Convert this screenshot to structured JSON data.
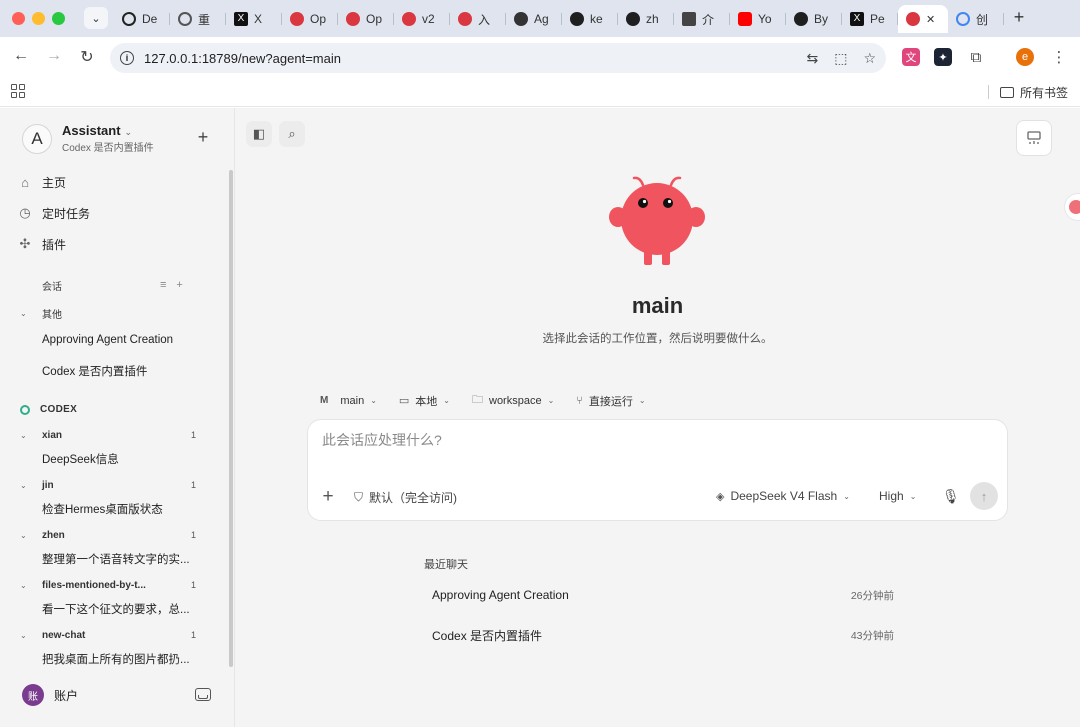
{
  "browser": {
    "tabs": [
      {
        "label": "De",
        "favicon": "ai-icon",
        "color": "#222222"
      },
      {
        "label": "重",
        "favicon": "openai-icon",
        "color": "#333333"
      },
      {
        "label": "X",
        "favicon": "x-icon",
        "color": "#111111"
      },
      {
        "label": "Op",
        "favicon": "crab-icon",
        "color": "#d93840"
      },
      {
        "label": "Op",
        "favicon": "crab-icon",
        "color": "#d93840"
      },
      {
        "label": "v2",
        "favicon": "crab-icon",
        "color": "#d93840"
      },
      {
        "label": "入",
        "favicon": "crab-icon",
        "color": "#d93840"
      },
      {
        "label": "Ag",
        "favicon": "agent-icon",
        "color": "#333333"
      },
      {
        "label": "ke",
        "favicon": "github-icon",
        "color": "#1f1f1f"
      },
      {
        "label": "zh",
        "favicon": "github-icon",
        "color": "#1f1f1f"
      },
      {
        "label": "介",
        "favicon": "doc-icon",
        "color": "#444444"
      },
      {
        "label": "Yo",
        "favicon": "youtube-icon",
        "color": "#ff0000"
      },
      {
        "label": "By",
        "favicon": "github-icon",
        "color": "#1f1f1f"
      },
      {
        "label": "Pe",
        "favicon": "x-icon",
        "color": "#111111"
      }
    ],
    "active_tab": {
      "favicon": "crab-icon",
      "color": "#d93840",
      "close": "✕"
    },
    "trailing_tab": {
      "label": "创",
      "favicon": "google-icon",
      "color": "#4285f4"
    },
    "url": "127.0.0.1:18789/new?agent=main",
    "bookmarks_folder": "所有书签",
    "profile_initial": "e"
  },
  "sidebar": {
    "workspace": {
      "initial": "A",
      "name": "Assistant",
      "subtitle": "Codex 是否内置插件"
    },
    "nav": [
      {
        "label": "主页",
        "icon": "home-icon"
      },
      {
        "label": "定时任务",
        "icon": "calendar-icon"
      },
      {
        "label": "插件",
        "icon": "puzzle-icon"
      }
    ],
    "sessions_label": "会话",
    "other_group": {
      "label": "其他",
      "items": [
        "Approving Agent Creation",
        "Codex 是否内置插件"
      ]
    },
    "codex_label": "CODEX",
    "codex_groups": [
      {
        "name": "xian",
        "count": "1",
        "item": "DeepSeek信息"
      },
      {
        "name": "jin",
        "count": "1",
        "item": "检查Hermes桌面版状态"
      },
      {
        "name": "zhen",
        "count": "1",
        "item": "整理第一个语音转文字的实..."
      },
      {
        "name": "files-mentioned-by-t...",
        "count": "1",
        "item": "看一下这个征文的要求，总..."
      },
      {
        "name": "new-chat",
        "count": "1",
        "item": "把我桌面上所有的图片都扔..."
      }
    ],
    "account": {
      "initial": "账",
      "label": "账户"
    }
  },
  "main": {
    "title": "main",
    "subtitle": "选择此会话的工作位置，然后说明要做什么。",
    "context": {
      "agent_badge": "M",
      "agent": "main",
      "location": "本地",
      "folder": "workspace",
      "mode": "直接运行"
    },
    "composer": {
      "placeholder": "此会话应处理什么?",
      "permission": "默认（完全访问)",
      "model": "DeepSeek V4 Flash",
      "effort": "High"
    },
    "recent_label": "最近聊天",
    "recent": [
      {
        "title": "Approving Agent Creation",
        "time": "26分钟前"
      },
      {
        "title": "Codex 是否内置插件",
        "time": "43分钟前"
      }
    ]
  },
  "colors": {
    "mascot": "#f0545e",
    "accent_codex": "#2fae8a",
    "account": "#7a3c8e"
  }
}
